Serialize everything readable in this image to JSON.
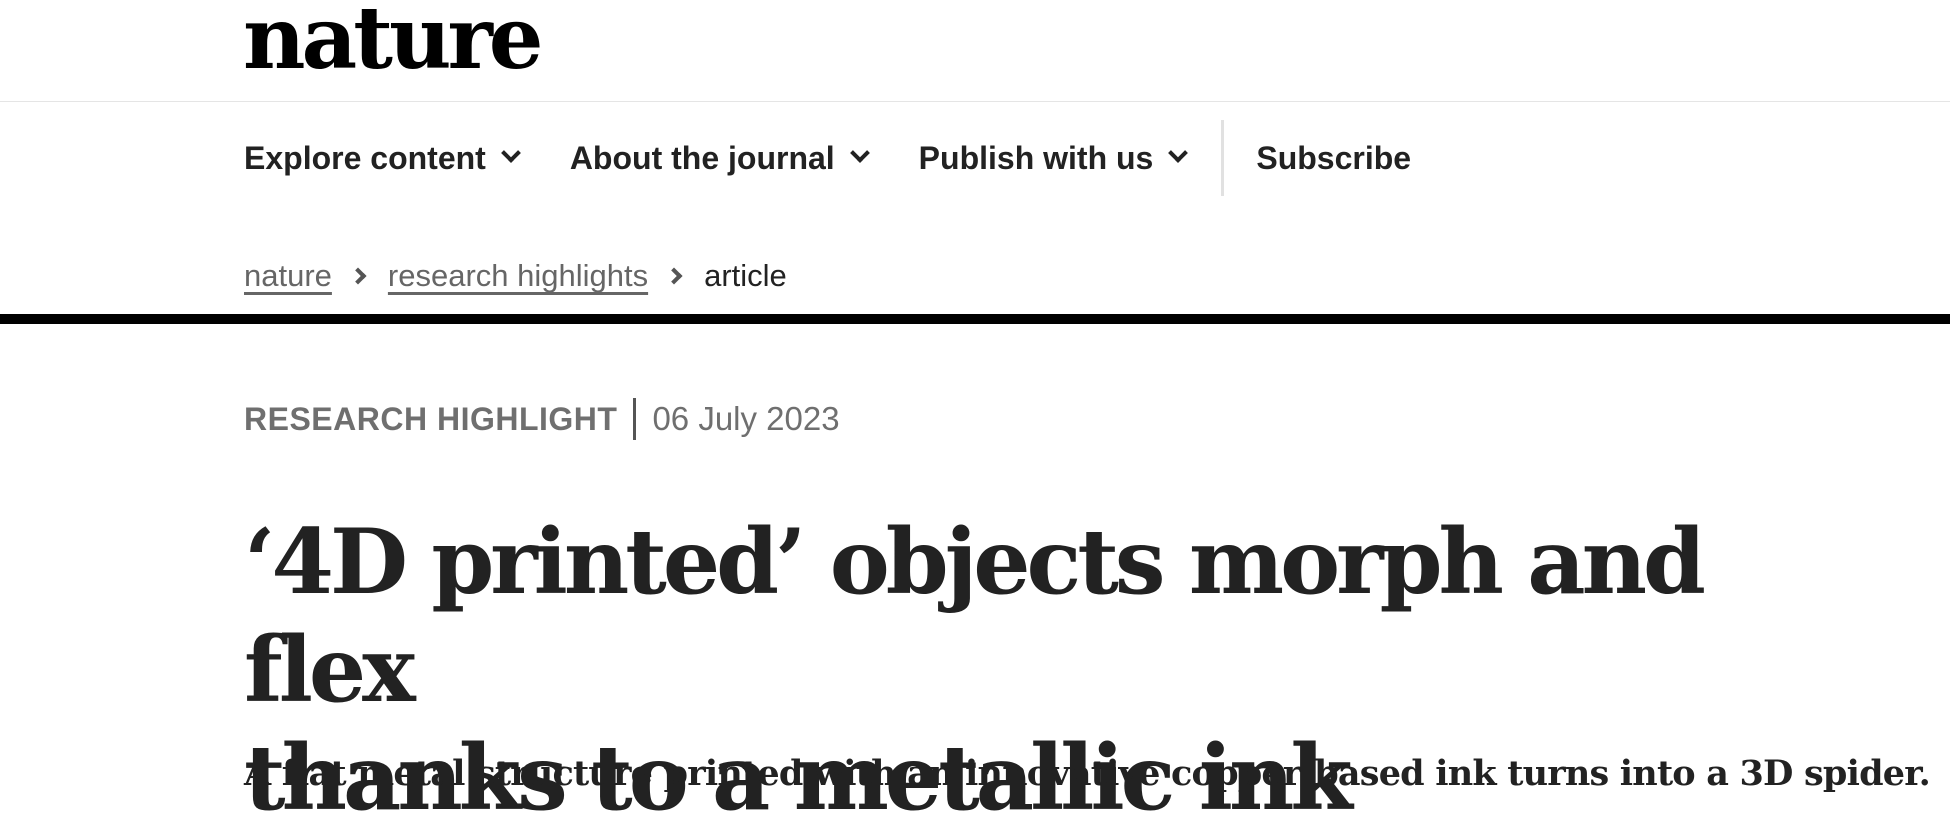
{
  "header": {
    "logo_text": "nature"
  },
  "nav": {
    "items": [
      {
        "label": "Explore content",
        "icon": "chevron-down-icon"
      },
      {
        "label": "About the journal",
        "icon": "chevron-down-icon"
      },
      {
        "label": "Publish with us",
        "icon": "chevron-down-icon"
      }
    ],
    "subscribe_label": "Subscribe"
  },
  "breadcrumb": {
    "items": [
      {
        "label": "nature",
        "link": true
      },
      {
        "label": "research highlights",
        "link": true
      },
      {
        "label": "article",
        "link": false
      }
    ],
    "separator_icon": "chevron-right-icon"
  },
  "article": {
    "type": "RESEARCH HIGHLIGHT",
    "date": "06 July 2023",
    "title_line1": "‘4D printed’ objects morph and flex",
    "title_line2": "thanks to a metallic ink",
    "standfirst": "A flat metal structure printed with an innovative copper-based ink turns into a 3D spider."
  },
  "colors": {
    "text": "#222222",
    "muted": "#6f6f6f",
    "rule": "#000000",
    "background": "#ffffff"
  }
}
